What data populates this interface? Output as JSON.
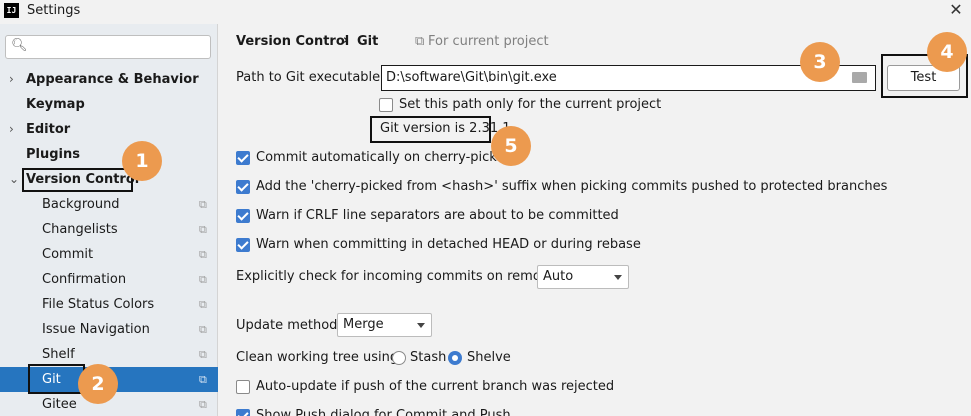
{
  "window": {
    "title": "Settings",
    "app_icon_text": "IJ",
    "close_glyph": "✕"
  },
  "search": {
    "placeholder": "",
    "icon": "search-icon"
  },
  "sidebar": {
    "items": [
      {
        "label": "Appearance & Behavior",
        "expanded": false
      },
      {
        "label": "Keymap"
      },
      {
        "label": "Editor",
        "expanded": false
      },
      {
        "label": "Plugins"
      },
      {
        "label": "Version Control",
        "expanded": true
      },
      {
        "label": "Background"
      },
      {
        "label": "Changelists"
      },
      {
        "label": "Commit"
      },
      {
        "label": "Confirmation"
      },
      {
        "label": "File Status Colors"
      },
      {
        "label": "Issue Navigation"
      },
      {
        "label": "Shelf"
      },
      {
        "label": "Git",
        "selected": true
      },
      {
        "label": "Gitee"
      }
    ]
  },
  "breadcrumb": {
    "parent": "Version Control",
    "separator": "›",
    "current": "Git",
    "scope": "For current project"
  },
  "git": {
    "path_label": "Path to Git executable:",
    "path_value": "D:\\software\\Git\\bin\\git.exe",
    "test_label": "Test",
    "current_project_only": "Set this path only for the current project",
    "version_text": "Git version is 2.31.1"
  },
  "options": [
    {
      "label": "Commit automatically on cherry-pick",
      "checked": true
    },
    {
      "label": "Add the 'cherry-picked from <hash>' suffix when picking commits pushed to protected branches",
      "checked": true
    },
    {
      "label": "Warn if CRLF line separators are about to be committed",
      "checked": true
    },
    {
      "label": "Warn when committing in detached HEAD or during rebase",
      "checked": true
    }
  ],
  "incoming": {
    "label": "Explicitly check for incoming commits on remotes:",
    "value": "Auto"
  },
  "update": {
    "label": "Update method:",
    "value": "Merge"
  },
  "clean": {
    "label": "Clean working tree using:",
    "options": [
      "Stash",
      "Shelve"
    ],
    "selected": "Shelve"
  },
  "auto_update": {
    "label": "Auto-update if push of the current branch was rejected",
    "checked": false
  },
  "show_push": {
    "label": "Show Push dialog for Commit and Push",
    "checked": true
  },
  "annotations": [
    "1",
    "2",
    "3",
    "4",
    "5"
  ],
  "colors": {
    "selection": "#2675bf",
    "accent": "#3d7bcf",
    "badge": "#ec9a4f"
  }
}
